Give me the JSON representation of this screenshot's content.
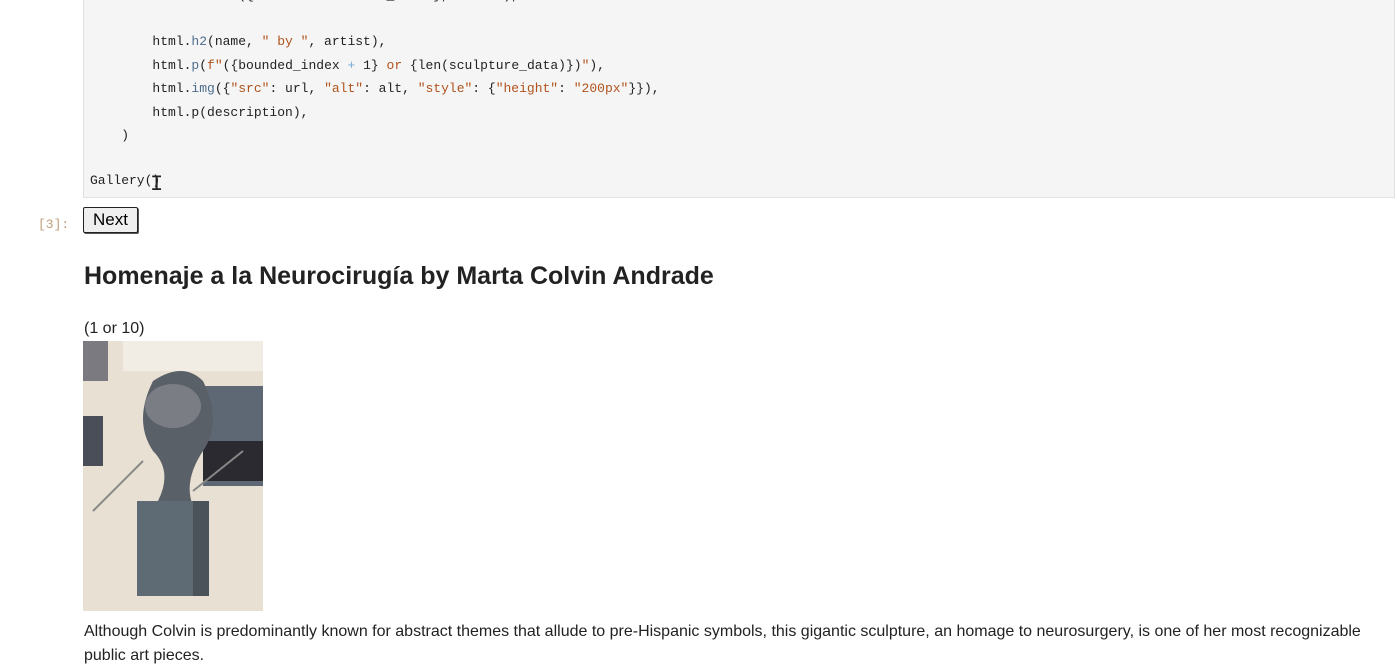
{
  "code": {
    "lines": [
      "        html.button({\"onClick\": handle_click}, \"Next\"),",
      "        html.h2(name, \" by \", artist),",
      "        html.p(f\"({bounded_index + 1} or {len(sculpture_data)})\"),",
      "        html.img({\"src\": url, \"alt\": alt, \"style\": {\"height\": \"200px\"}}),",
      "        html.p(description),",
      "    )",
      "Gallery()"
    ]
  },
  "output": {
    "prompt": "[3]:",
    "next_button": "Next",
    "title": "Homenaje a la Neurocirugía by Marta Colvin Andrade",
    "counter": "(1 or 10)",
    "image_alt": "sculpture image",
    "description": "Although Colvin is predominantly known for abstract themes that allude to pre-Hispanic symbols, this gigantic sculpture, an homage to neurosurgery, is one of her most recognizable public art pieces."
  }
}
